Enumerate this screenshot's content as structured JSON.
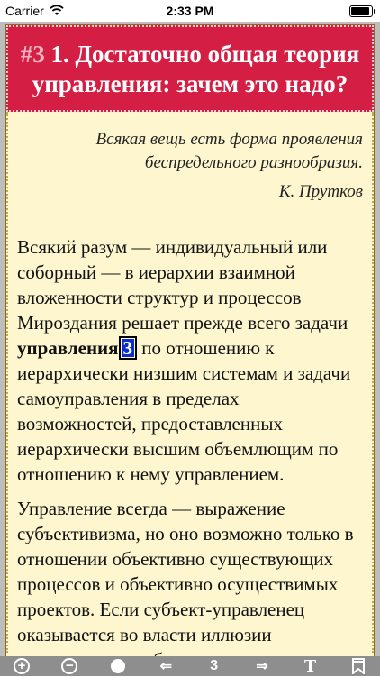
{
  "status_bar": {
    "carrier": "Carrier",
    "time": "2:33 PM",
    "battery_level": 1.0
  },
  "chapter": {
    "number": "#3",
    "title": "1. Достаточно общая теория управления: зачем это надо?"
  },
  "epigraph": {
    "text": "Всякая вещь есть форма проявления беспредельного разнообразия.",
    "author": "К. Прутков"
  },
  "paragraph1": {
    "before": "Всякий разум — индивидуальный или соборный — в иерархии взаимной вложенности структур и процессов Мироздания решает прежде всего задачи ",
    "bold": "управления",
    "ref": "3",
    "after": " по отношению к иерархически низшим системам и задачи самоуправления в пределах возможностей, предоставленных иерархически высшим объемлющим по отношению к нему управлением."
  },
  "paragraph2": {
    "text": "Управление всегда — выражение субъективизма, но оно возможно только в отношении объективно существующих процессов и объективно осуществимых проектов. Если субъект-управленец оказывается во власти иллюзии существования объекта"
  },
  "toolbar": {
    "zoom_in": "+",
    "zoom_out": "−",
    "back_arrow": "⇐",
    "page_number": "3",
    "forward_arrow": "⇒",
    "font_label": "T"
  },
  "icons": {
    "zoom_in": "plus-circle-icon",
    "zoom_out": "minus-circle-icon",
    "mode": "filled-circle-icon",
    "back": "arrow-left-icon",
    "forward": "arrow-right-icon",
    "font": "text-format-icon",
    "bookmark": "bookmark-icon"
  },
  "colors": {
    "title_background": "#d41e43",
    "page_background": "#fdf6cf",
    "reference_badge": "#0d2ecf",
    "toolbar": "#8e8e8e"
  }
}
